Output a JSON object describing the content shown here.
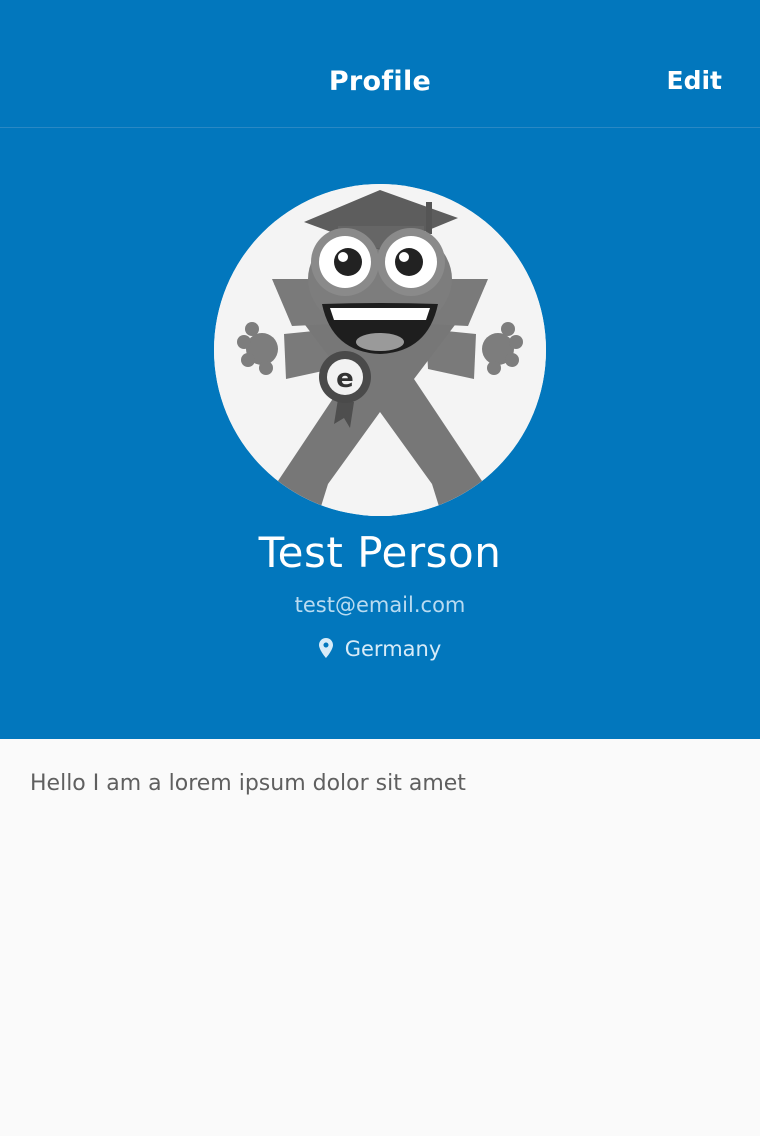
{
  "navbar": {
    "title": "Profile",
    "edit_label": "Edit"
  },
  "profile": {
    "name": "Test Person",
    "email": "test@email.com",
    "location": "Germany",
    "bio": "Hello I am a lorem ipsum dolor sit amet"
  },
  "icons": {
    "location": "map-pin-icon",
    "avatar": "mascot-avatar"
  },
  "colors": {
    "primary": "#0277bd",
    "background": "#fafafa",
    "header_text": "#ffffff",
    "email_text": "#b9dbf1",
    "bio_text": "#5f5f5f"
  }
}
